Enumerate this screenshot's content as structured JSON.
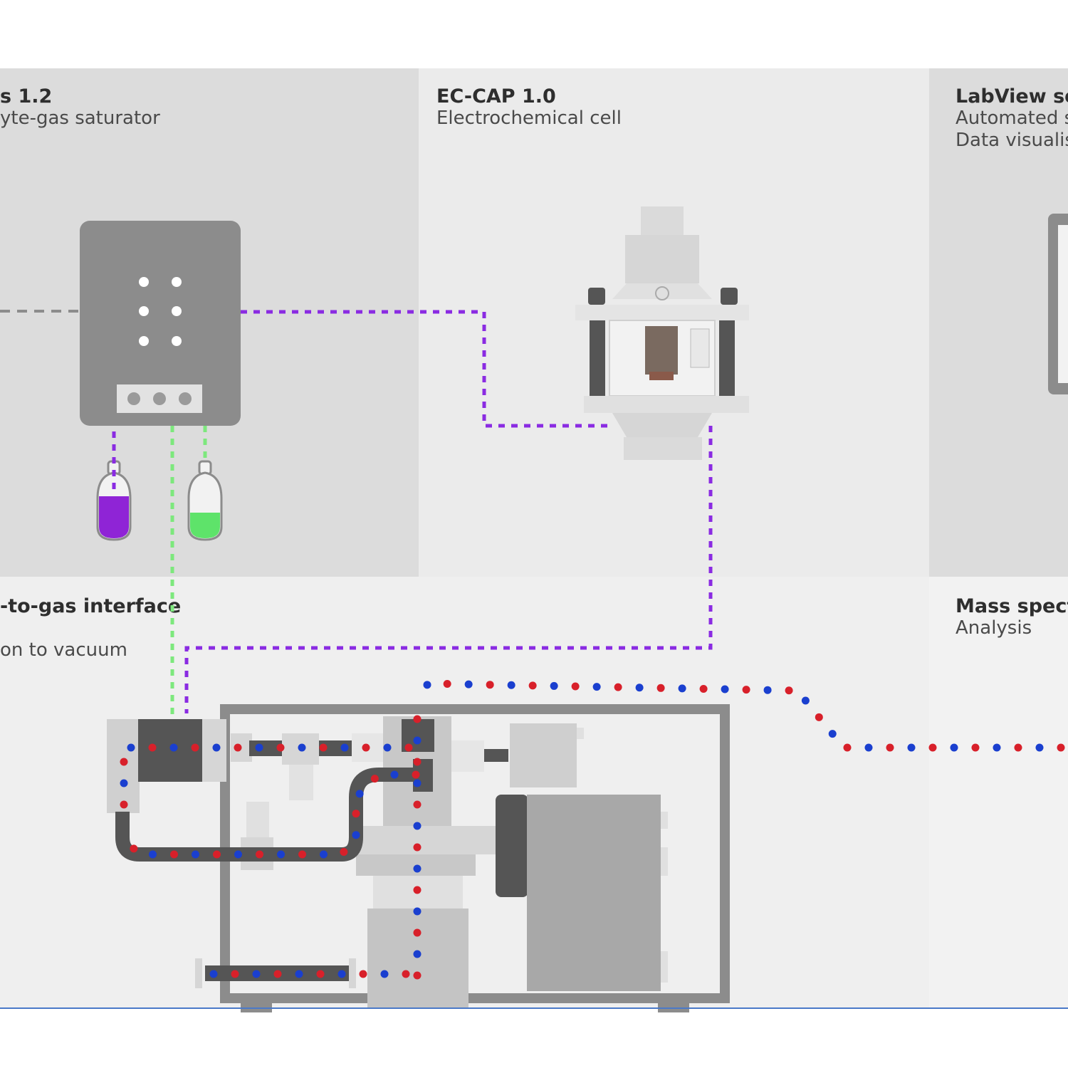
{
  "panels": {
    "saturator": {
      "title": "s 1.2",
      "subtitle": "yte-gas saturator"
    },
    "ec_cap": {
      "title": "EC-CAP 1.0",
      "subtitle": "Electrochemical cell"
    },
    "labview": {
      "title": "LabView soft",
      "line1": "Automated s",
      "line2": "Data visualisa"
    },
    "interface": {
      "title": "-to-gas interface",
      "line2": "on to vacuum"
    },
    "mass_spec": {
      "title": "Mass spectro",
      "subtitle": "Analysis"
    }
  },
  "colors": {
    "page_bg": "#ffffff",
    "panel_dark": "#dcdcdc",
    "panel_light": "#ececec",
    "device_gray": "#8c8c8c",
    "purple_line": "#8a2be2",
    "green_line": "#7de87d",
    "dot_red": "#d8202a",
    "dot_blue": "#1a3fcf",
    "liquid_purple": "#8f24d6",
    "liquid_green": "#5ee36a",
    "bottom_rule": "#4a79c8"
  }
}
